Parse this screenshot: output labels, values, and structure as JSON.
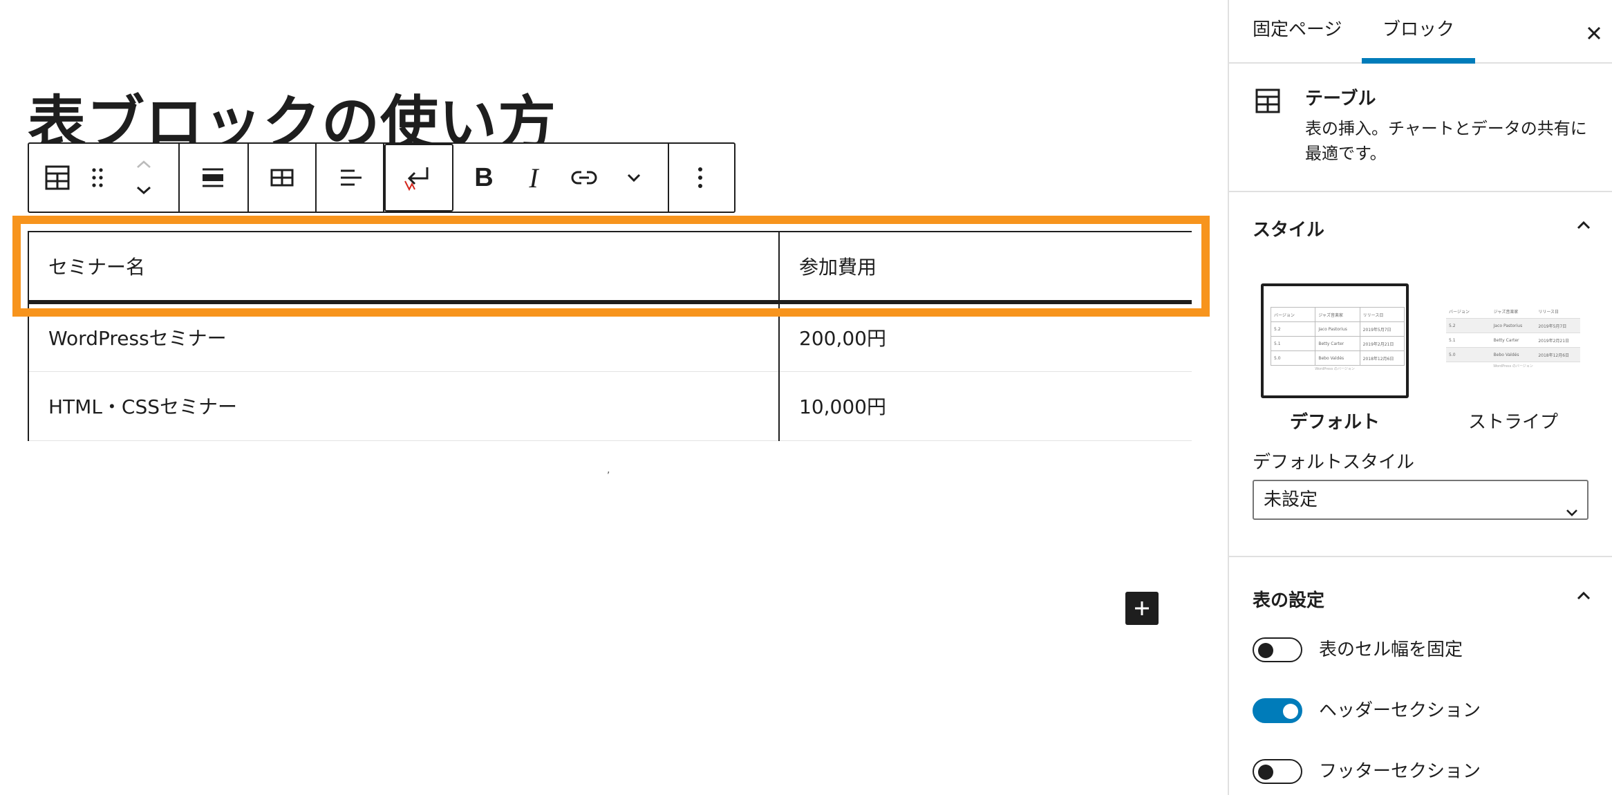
{
  "editor": {
    "page_title": "表ブロックの使い方",
    "table": {
      "headers": [
        "セミナー名",
        "参加費用"
      ],
      "rows": [
        [
          "WordPressセミナー",
          "200,00円"
        ],
        [
          "HTML・CSSセミナー",
          "10,000円"
        ]
      ]
    },
    "stray_mark": ","
  },
  "toolbar": {
    "bold_label": "B",
    "italic_label": "I"
  },
  "sidebar": {
    "tabs": [
      "固定ページ",
      "ブロック"
    ],
    "active_tab": "ブロック",
    "block_card": {
      "title": "テーブル",
      "description": "表の挿入。チャートとデータの共有に最適です。"
    },
    "styles_panel": {
      "title": "スタイル",
      "options": [
        "デフォルト",
        "ストライプ"
      ],
      "selected": "デフォルト",
      "preview_headers": [
        "バージョン",
        "ジャズ音楽家",
        "リリース日"
      ],
      "preview_rows": [
        [
          "5.2",
          "Jaco Pastorius",
          "2019年5月7日"
        ],
        [
          "5.1",
          "Betty Carter",
          "2019年2月21日"
        ],
        [
          "5.0",
          "Bebo Valdés",
          "2018年12月6日"
        ]
      ],
      "preview_caption": "WordPress のバージョン",
      "default_style_label": "デフォルトスタイル",
      "default_style_value": "未設定"
    },
    "table_settings": {
      "title": "表の設定",
      "toggles": [
        {
          "label": "表のセル幅を固定",
          "checked": false
        },
        {
          "label": "ヘッダーセクション",
          "checked": true
        },
        {
          "label": "フッターセクション",
          "checked": false
        }
      ]
    }
  },
  "colors": {
    "highlight": "#f7941d",
    "accent": "#007cba",
    "dark": "#1e1e1e"
  }
}
